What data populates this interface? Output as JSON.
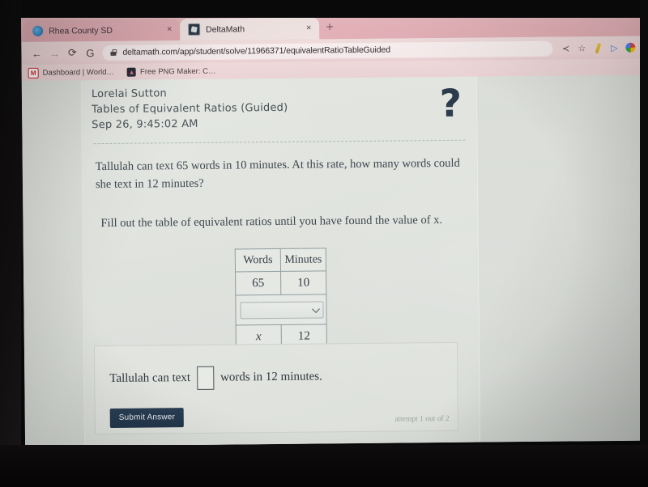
{
  "browser": {
    "tabs": [
      {
        "title": "Rhea County SD",
        "favicon": "cloud-icon",
        "active": false,
        "close_label": "×"
      },
      {
        "title": "DeltaMath",
        "favicon": "deltamath-icon",
        "active": true,
        "close_label": "×"
      }
    ],
    "new_tab_label": "+",
    "nav": {
      "back_label": "←",
      "forward_label": "→",
      "reload_label": "⟳",
      "google_label": "G"
    },
    "omnibox": {
      "url": "deltamath.com/app/student/solve/11966371/equivalentRatioTableGuided",
      "placeholder": "Search Google or type a URL",
      "lock_icon": "lock-icon"
    },
    "toolbar_icons": [
      {
        "name": "share-icon",
        "glyph": "≺"
      },
      {
        "name": "bookmark-star-icon",
        "glyph": "☆"
      },
      {
        "name": "pen-extension-icon",
        "glyph": ""
      },
      {
        "name": "cursor-extension-icon",
        "glyph": "▷"
      },
      {
        "name": "profile-avatar-icon",
        "glyph": ""
      }
    ],
    "bookmarks": [
      {
        "label": "Dashboard | World…",
        "icon": "M"
      },
      {
        "label": "Free PNG Maker: C…",
        "icon": "▲"
      }
    ]
  },
  "page": {
    "student_name": "Lorelai Sutton",
    "assignment_title": "Tables of Equivalent Ratios (Guided)",
    "timestamp": "Sep 26, 9:45:02 AM",
    "help_icon_label": "?",
    "problem_text": "Tallulah can text 65 words in 10 minutes. At this rate, how many words could she text in 12 minutes?",
    "sub_prompt": "Fill out the table of equivalent ratios until you have found the value of x.",
    "table": {
      "headers": [
        "Words",
        "Minutes"
      ],
      "rows": [
        {
          "type": "values",
          "cells": [
            "65",
            "10"
          ]
        },
        {
          "type": "select",
          "selected": "",
          "chevron": "chevron-down-icon"
        },
        {
          "type": "values",
          "cells": [
            "x",
            "12"
          ],
          "italic_first": true
        }
      ]
    },
    "answer": {
      "prefix": "Tallulah can text",
      "input_value": "",
      "input_placeholder": "",
      "suffix": "words in 12 minutes.",
      "submit_label": "Submit Answer",
      "attempt_text": "attempt 1 out of 2"
    },
    "colors": {
      "submit_button": "#22364a",
      "help_icon": "#2c3b4c",
      "page_background": "#dfe2dd",
      "browser_chrome": "#e9bdc2"
    }
  }
}
